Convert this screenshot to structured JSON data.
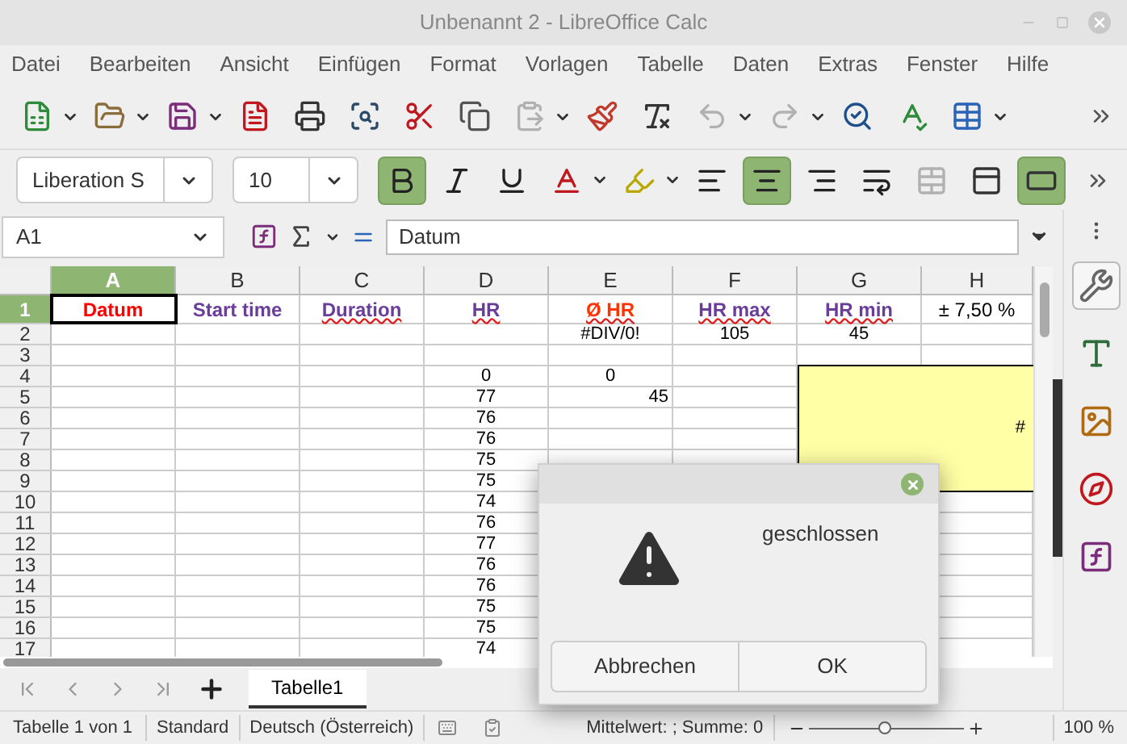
{
  "window": {
    "title": "Unbenannt 2 - LibreOffice Calc"
  },
  "menu": [
    "Datei",
    "Bearbeiten",
    "Ansicht",
    "Einfügen",
    "Format",
    "Vorlagen",
    "Tabelle",
    "Daten",
    "Extras",
    "Fenster",
    "Hilfe"
  ],
  "standard_toolbar": [
    {
      "kind": "new",
      "dropdown": true,
      "disabled": false
    },
    {
      "kind": "open",
      "dropdown": true,
      "disabled": false
    },
    {
      "kind": "save",
      "dropdown": true,
      "disabled": false
    },
    {
      "kind": "pdf",
      "dropdown": false,
      "disabled": false
    },
    {
      "kind": "print",
      "dropdown": false,
      "disabled": false
    },
    {
      "kind": "preview",
      "dropdown": false,
      "disabled": false
    },
    {
      "kind": "cut",
      "dropdown": false,
      "disabled": false
    },
    {
      "kind": "copy",
      "dropdown": false,
      "disabled": false
    },
    {
      "kind": "paste",
      "dropdown": true,
      "disabled": true
    },
    {
      "kind": "brush",
      "dropdown": false,
      "disabled": false
    },
    {
      "kind": "clear",
      "dropdown": false,
      "disabled": false
    },
    {
      "kind": "undo",
      "dropdown": true,
      "disabled": true
    },
    {
      "kind": "redo",
      "dropdown": true,
      "disabled": true
    },
    {
      "kind": "find",
      "dropdown": false,
      "disabled": false
    },
    {
      "kind": "spell",
      "dropdown": false,
      "disabled": false
    },
    {
      "kind": "table",
      "dropdown": true,
      "disabled": false
    }
  ],
  "format_toolbar": {
    "font_name": "Liberation S",
    "font_size": "10",
    "buttons": [
      {
        "kind": "bold",
        "selected": true,
        "dropdown": false,
        "disabled": false
      },
      {
        "kind": "italic",
        "selected": false,
        "dropdown": false,
        "disabled": false
      },
      {
        "kind": "underline",
        "selected": false,
        "dropdown": false,
        "disabled": false
      },
      {
        "kind": "font-color",
        "selected": false,
        "dropdown": true,
        "disabled": false
      },
      {
        "kind": "highlight",
        "selected": false,
        "dropdown": true,
        "disabled": false
      },
      {
        "kind": "align-left",
        "selected": false,
        "dropdown": false,
        "disabled": false
      },
      {
        "kind": "align-center",
        "selected": true,
        "dropdown": false,
        "disabled": false
      },
      {
        "kind": "align-right",
        "selected": false,
        "dropdown": false,
        "disabled": false
      },
      {
        "kind": "wrap",
        "selected": false,
        "dropdown": false,
        "disabled": false
      },
      {
        "kind": "merge",
        "selected": false,
        "dropdown": false,
        "disabled": true
      },
      {
        "kind": "valign-top",
        "selected": false,
        "dropdown": false,
        "disabled": false
      },
      {
        "kind": "valign-center",
        "selected": true,
        "dropdown": false,
        "disabled": false
      }
    ]
  },
  "formula_bar": {
    "name_box": "A1",
    "formula": "Datum"
  },
  "columns": [
    {
      "label": "A",
      "selected": true
    },
    {
      "label": "B",
      "selected": false
    },
    {
      "label": "C",
      "selected": false
    },
    {
      "label": "D",
      "selected": false
    },
    {
      "label": "E",
      "selected": false
    },
    {
      "label": "F",
      "selected": false
    },
    {
      "label": "G",
      "selected": false
    },
    {
      "label": "H",
      "selected": false
    }
  ],
  "rows": [
    {
      "number": "1",
      "selected": true,
      "kind": "header",
      "cells": [
        {
          "text": "Datum",
          "color": "#ff0000",
          "bold": true,
          "spell_error": false
        },
        {
          "text": "Start time",
          "color": "#6a3d9a",
          "bold": true,
          "spell_error": false
        },
        {
          "text": "Duration",
          "color": "#6a3d9a",
          "bold": true,
          "spell_error": true
        },
        {
          "text": "HR",
          "color": "#6a3d9a",
          "bold": true,
          "spell_error": true
        },
        {
          "text": "Ø HR",
          "color": "#ff3300",
          "bold": true,
          "spell_error": true
        },
        {
          "text": "HR max",
          "color": "#6a3d9a",
          "bold": true,
          "spell_error": true
        },
        {
          "text": "HR min",
          "color": "#6a3d9a",
          "bold": true,
          "spell_error": true
        },
        {
          "text": "± 7,50  %",
          "color": "#000000",
          "bold": false,
          "spell_error": false
        }
      ]
    },
    {
      "number": "2",
      "selected": false,
      "kind": "data",
      "cells": [
        "",
        "",
        "",
        "",
        "#DIV/0!",
        "105",
        "45",
        ""
      ]
    },
    {
      "number": "3",
      "selected": false,
      "kind": "data",
      "cells": [
        "",
        "",
        "",
        "",
        "",
        "",
        "",
        ""
      ]
    },
    {
      "number": "4",
      "selected": false,
      "kind": "data",
      "cells": [
        "",
        "",
        "",
        "0",
        "0",
        "",
        "",
        ""
      ]
    },
    {
      "number": "5",
      "selected": false,
      "kind": "data",
      "cells": [
        "",
        "",
        "",
        "77",
        {
          "text": "45",
          "align_right": true
        },
        "",
        "",
        ""
      ]
    },
    {
      "number": "6",
      "selected": false,
      "kind": "data",
      "cells": [
        "",
        "",
        "",
        "76",
        "",
        "",
        "",
        ""
      ]
    },
    {
      "number": "7",
      "selected": false,
      "kind": "data",
      "cells": [
        "",
        "",
        "",
        "76",
        "",
        "",
        "",
        ""
      ]
    },
    {
      "number": "8",
      "selected": false,
      "kind": "data",
      "cells": [
        "",
        "",
        "",
        "75",
        "",
        "",
        "",
        ""
      ]
    },
    {
      "number": "9",
      "selected": false,
      "kind": "data",
      "cells": [
        "",
        "",
        "",
        "75",
        "",
        "",
        "",
        ""
      ]
    },
    {
      "number": "10",
      "selected": false,
      "kind": "data",
      "cells": [
        "",
        "",
        "",
        "74",
        "",
        "",
        "",
        ""
      ]
    },
    {
      "number": "11",
      "selected": false,
      "kind": "data",
      "cells": [
        "",
        "",
        "",
        "76",
        "",
        "",
        "",
        ""
      ]
    },
    {
      "number": "12",
      "selected": false,
      "kind": "data",
      "cells": [
        "",
        "",
        "",
        "77",
        "",
        "",
        "",
        ""
      ]
    },
    {
      "number": "13",
      "selected": false,
      "kind": "data",
      "cells": [
        "",
        "",
        "",
        "76",
        "",
        "",
        "",
        ""
      ]
    },
    {
      "number": "14",
      "selected": false,
      "kind": "data",
      "cells": [
        "",
        "",
        "",
        "76",
        "",
        "",
        "",
        ""
      ]
    },
    {
      "number": "15",
      "selected": false,
      "kind": "data",
      "cells": [
        "",
        "",
        "",
        "75",
        "",
        "",
        "",
        ""
      ]
    },
    {
      "number": "16",
      "selected": false,
      "kind": "data",
      "cells": [
        "",
        "",
        "",
        "75",
        "",
        "",
        "",
        ""
      ]
    },
    {
      "number": "17",
      "selected": false,
      "kind": "data",
      "cells": [
        "",
        "",
        "",
        "74",
        "",
        "",
        "",
        ""
      ]
    }
  ],
  "comment_note": {
    "text": "#"
  },
  "sheet_tabs": [
    {
      "label": "Tabelle1",
      "selected": true
    }
  ],
  "sidebar": [
    {
      "kind": "properties",
      "selected": true
    },
    {
      "kind": "styles",
      "selected": false
    },
    {
      "kind": "gallery",
      "selected": false
    },
    {
      "kind": "navigator",
      "selected": false
    },
    {
      "kind": "functions",
      "selected": false
    }
  ],
  "dialog": {
    "message": "geschlossen",
    "buttons": [
      "Abbrechen",
      "OK"
    ]
  },
  "status_bar": {
    "sheet": "Tabelle 1 von 1",
    "page_style": "Standard",
    "language": "Deutsch (Österreich)",
    "selection": "Mittelwert: ; Summe: 0",
    "zoom": {
      "level": 0.49,
      "reading": "100 %"
    }
  }
}
